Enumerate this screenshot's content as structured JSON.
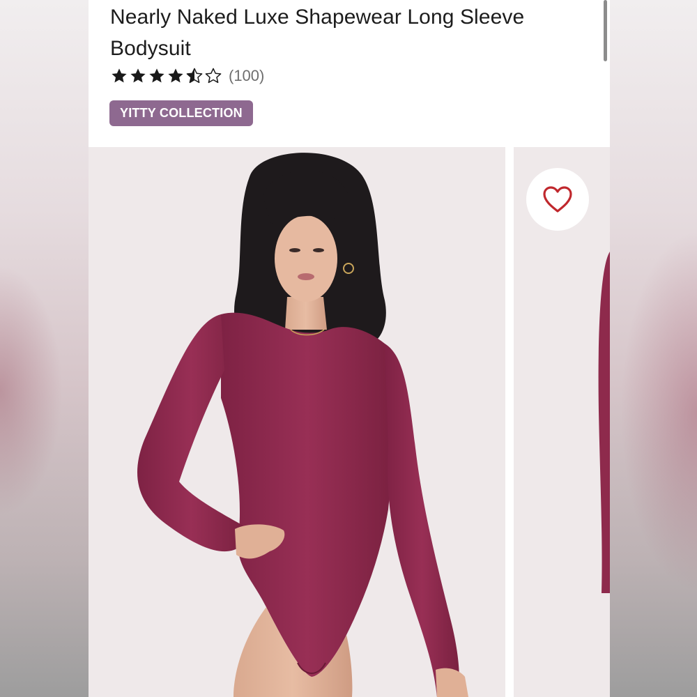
{
  "product": {
    "title": "Nearly Naked Luxe Shapewear Long Sleeve Bodysuit",
    "rating_value": 4.5,
    "rating_max": 5,
    "review_count": "(100)",
    "badge": "YITTY COLLECTION"
  },
  "colors": {
    "badge_bg": "#8e6990",
    "heart": "#c0282d",
    "star_fill": "#1a1a1a",
    "garment": "#8e2a4c"
  },
  "icons": {
    "rating": "star-icon",
    "favorite": "heart-outline-icon"
  }
}
